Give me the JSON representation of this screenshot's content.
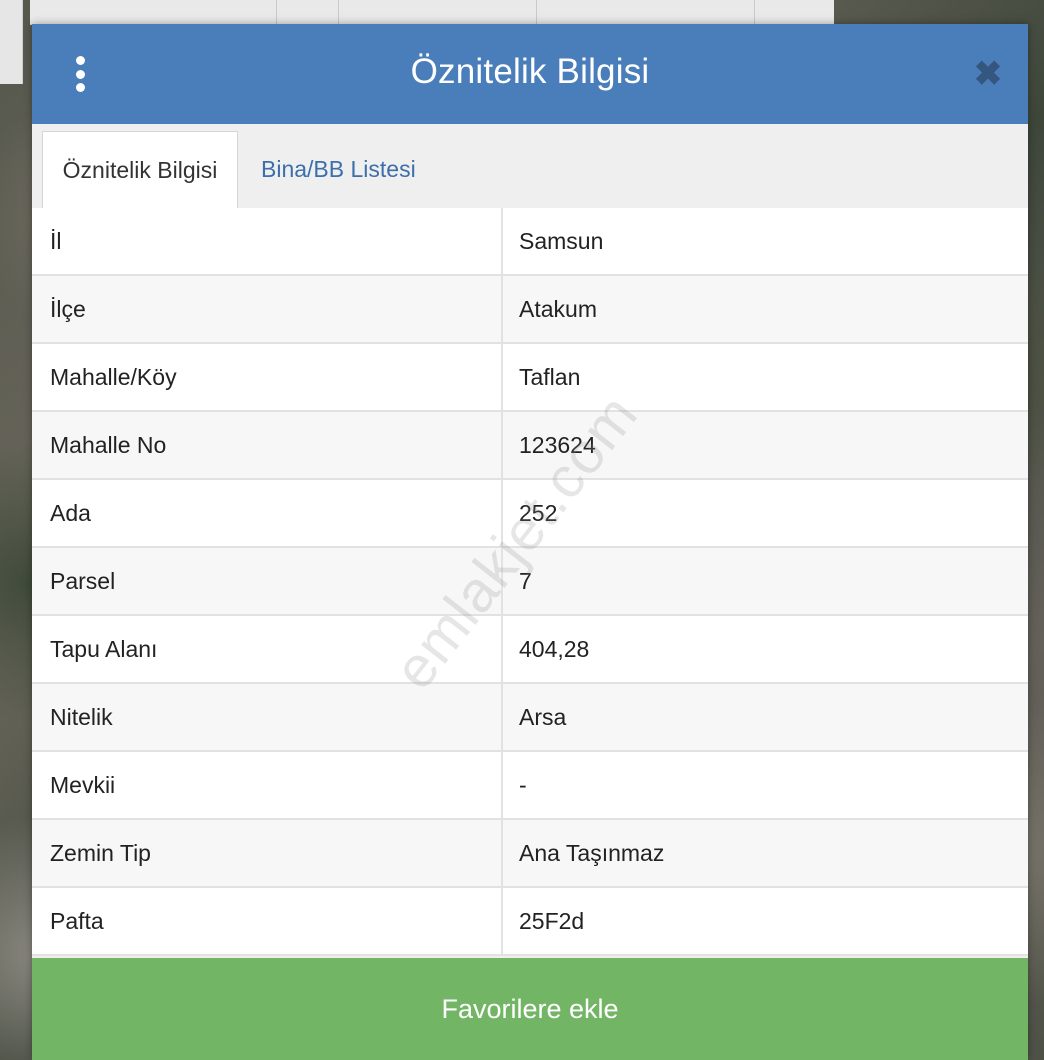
{
  "modal": {
    "title": "Öznitelik Bilgisi",
    "close_symbol": "✖",
    "menu_icon": "kebab-menu-icon",
    "close_icon": "close-icon"
  },
  "tabs": [
    {
      "label": "Öznitelik Bilgisi",
      "active": true
    },
    {
      "label": "Bina/BB Listesi",
      "active": false
    }
  ],
  "attributes": [
    {
      "label": "İl",
      "value": "Samsun"
    },
    {
      "label": "İlçe",
      "value": "Atakum"
    },
    {
      "label": "Mahalle/Köy",
      "value": "Taflan"
    },
    {
      "label": "Mahalle No",
      "value": "123624"
    },
    {
      "label": "Ada",
      "value": "252"
    },
    {
      "label": "Parsel",
      "value": "7"
    },
    {
      "label": "Tapu Alanı",
      "value": "404,28"
    },
    {
      "label": "Nitelik",
      "value": "Arsa"
    },
    {
      "label": "Mevkii",
      "value": "-"
    },
    {
      "label": "Zemin Tip",
      "value": "Ana Taşınmaz"
    },
    {
      "label": "Pafta",
      "value": "25F2d"
    }
  ],
  "actions": {
    "favorite_label": "Favorilere ekle"
  },
  "watermark": "emlakjet.com",
  "colors": {
    "header": "#4a7ebb",
    "tab_link": "#3c6fab",
    "favorite_button": "#72b565"
  }
}
